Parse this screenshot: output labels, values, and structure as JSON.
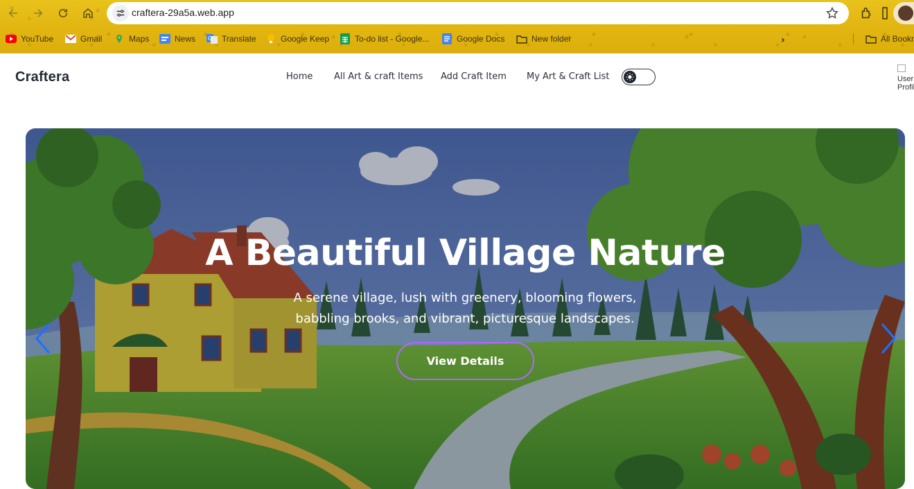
{
  "browser": {
    "url": "craftera-29a5a.web.app",
    "bookmarks": [
      {
        "label": "YouTube",
        "icon": "youtube-icon"
      },
      {
        "label": "Gmail",
        "icon": "gmail-icon"
      },
      {
        "label": "Maps",
        "icon": "maps-icon"
      },
      {
        "label": "News",
        "icon": "news-icon"
      },
      {
        "label": "Translate",
        "icon": "translate-icon"
      },
      {
        "label": "Google Keep",
        "icon": "keep-icon"
      },
      {
        "label": "To-do list - Google...",
        "icon": "sheets-icon"
      },
      {
        "label": "Google Docs",
        "icon": "docs-icon"
      },
      {
        "label": "New folder",
        "icon": "folder-icon"
      }
    ],
    "all_bookmarks": "All Bookm",
    "theme_color": "#e3b712"
  },
  "site": {
    "brand": "Craftera",
    "nav": {
      "home": "Home",
      "all_items": "All Art & craft Items",
      "add_item": "Add Craft Item",
      "my_list": "My Art & Craft List"
    },
    "user_image_alt": "User Profile"
  },
  "hero": {
    "title": "A Beautiful Village Nature",
    "subtitle": "A serene village, lush with greenery, blooming flowers, babbling brooks, and vibrant, picturesque landscapes.",
    "button": "View Details",
    "accent_color": "#b166ff",
    "arrow_color": "#1e6fff"
  }
}
